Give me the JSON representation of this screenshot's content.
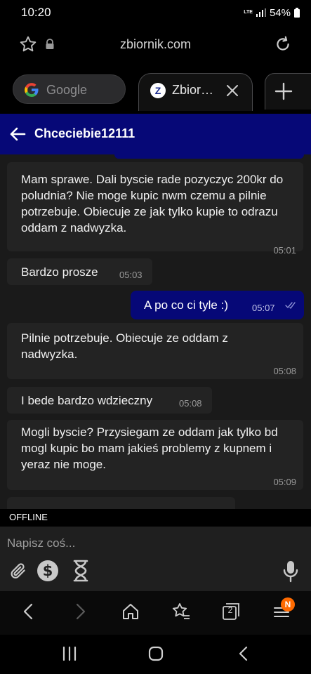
{
  "status_bar": {
    "time": "10:20",
    "network": "LTE",
    "battery": "54%"
  },
  "address_bar": {
    "url": "zbiornik.com"
  },
  "tabs": [
    {
      "label": "Google",
      "icon": "google-logo"
    },
    {
      "label": "Zbior…",
      "icon": "zbiornik-favicon",
      "favicon_letter": "Z"
    }
  ],
  "chat": {
    "contact_name": "Chceciebie12111",
    "messages": [
      {
        "direction": "in",
        "text": "Mam sprawe. Dali byscie rade pozyczyc 200kr do poludnia? Nie moge kupic nwm czemu a pilnie potrzebuje. Obiecuje ze jak tylko kupie to odrazu oddam z nadwyzka.",
        "time": "05:01"
      },
      {
        "direction": "in",
        "text": "Bardzo prosze",
        "time": "05:03"
      },
      {
        "direction": "out",
        "text": "A po co ci tyle :)",
        "time": "05:07",
        "read": true
      },
      {
        "direction": "in",
        "text": "Pilnie potrzebuje. Obiecuje ze oddam z nadwyzka.",
        "time": "05:08"
      },
      {
        "direction": "in",
        "text": "I bede bardzo wdzieczny",
        "time": "05:08"
      },
      {
        "direction": "in",
        "text": "Mogli byscie? Przysiegam ze oddam jak tylko bd mogl kupic bo mam jakieś problemy z kupnem i yeraz nie moge.",
        "time": "05:09"
      }
    ]
  },
  "composer": {
    "status_badge": "OFFLINE",
    "placeholder": "Napisz coś..."
  },
  "browser_toolbar": {
    "tabs_count": "2",
    "menu_badge": "N"
  },
  "colors": {
    "header_bg": "#060877",
    "outgoing_bubble": "#060877",
    "incoming_bubble": "#232323",
    "badge_orange": "#ff6a00"
  }
}
